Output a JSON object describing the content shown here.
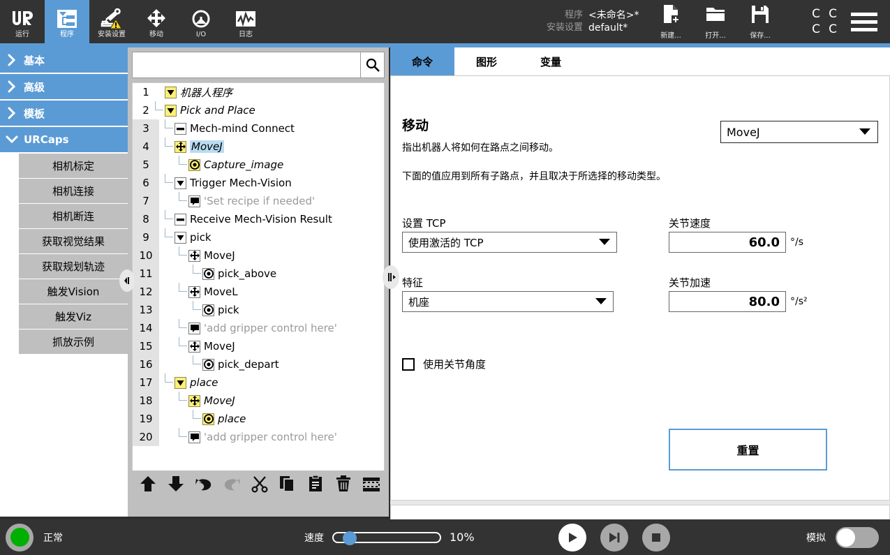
{
  "topnav": {
    "tabs": [
      {
        "label": "运行",
        "icon": "ur-logo-icon",
        "active": false
      },
      {
        "label": "程序",
        "icon": "program-tree-icon",
        "active": true
      },
      {
        "label": "安装设置",
        "icon": "robot-warning-icon",
        "active": false
      },
      {
        "label": "移动",
        "icon": "move-arrows-icon",
        "active": false
      },
      {
        "label": "I/O",
        "icon": "io-icon",
        "active": false
      },
      {
        "label": "日志",
        "icon": "log-waveform-icon",
        "active": false
      }
    ],
    "program_key": "程序",
    "program_value": "<未命名>*",
    "installation_key": "安装设置",
    "installation_value": "default*",
    "file_buttons": [
      {
        "label": "新建...",
        "icon": "new-file-icon"
      },
      {
        "label": "打开...",
        "icon": "open-folder-icon"
      },
      {
        "label": "保存...",
        "icon": "save-disk-icon"
      }
    ],
    "cc_letters": [
      "C",
      "C",
      "C",
      "C"
    ],
    "menu_icon": "hamburger-menu-icon",
    "accent_color": "#5b9bd5"
  },
  "sidebar": {
    "groups": [
      {
        "label": "基本",
        "expanded": false
      },
      {
        "label": "高级",
        "expanded": false
      },
      {
        "label": "模板",
        "expanded": false
      },
      {
        "label": "URCaps",
        "expanded": true
      }
    ],
    "urcaps_items": [
      "相机标定",
      "相机连接",
      "相机断连",
      "获取视觉结果",
      "获取规划轨迹",
      "触发Vision",
      "触发Viz",
      "抓放示例"
    ]
  },
  "tree_panel": {
    "search_value": "",
    "search_placeholder": "",
    "search_icon": "search-icon",
    "rows": [
      {
        "no": "1",
        "indent": 0,
        "icon": "folder-triangle",
        "hl": true,
        "label": "机器人程序",
        "italic": true,
        "dim": false,
        "selected": false,
        "gutter": "plain"
      },
      {
        "no": "2",
        "indent": 1,
        "icon": "folder-triangle",
        "hl": true,
        "label": "Pick and Place",
        "italic": true,
        "dim": false,
        "selected": false,
        "gutter": "plain"
      },
      {
        "no": "3",
        "indent": 2,
        "icon": "dash",
        "hl": false,
        "label": "Mech-mind Connect",
        "italic": false,
        "dim": false,
        "selected": false,
        "gutter": "gray"
      },
      {
        "no": "4",
        "indent": 2,
        "icon": "move-cross",
        "hl": true,
        "label": "MoveJ",
        "italic": true,
        "dim": false,
        "selected": true,
        "gutter": "gray"
      },
      {
        "no": "5",
        "indent": 3,
        "icon": "waypoint",
        "hl": true,
        "label": "Capture_image",
        "italic": true,
        "dim": false,
        "selected": false,
        "gutter": "gray"
      },
      {
        "no": "6",
        "indent": 2,
        "icon": "folder-triangle",
        "hl": false,
        "label": "Trigger Mech-Vision",
        "italic": false,
        "dim": false,
        "selected": false,
        "gutter": "gray"
      },
      {
        "no": "7",
        "indent": 3,
        "icon": "comment",
        "hl": false,
        "label": "'Set recipe if needed'",
        "italic": false,
        "dim": true,
        "selected": false,
        "gutter": "gray"
      },
      {
        "no": "8",
        "indent": 2,
        "icon": "dash",
        "hl": false,
        "label": "Receive Mech-Vision Result",
        "italic": false,
        "dim": false,
        "selected": false,
        "gutter": "gray"
      },
      {
        "no": "9",
        "indent": 2,
        "icon": "folder-triangle",
        "hl": false,
        "label": "pick",
        "italic": false,
        "dim": false,
        "selected": false,
        "gutter": "gray"
      },
      {
        "no": "10",
        "indent": 3,
        "icon": "move-cross",
        "hl": false,
        "label": "MoveJ",
        "italic": false,
        "dim": false,
        "selected": false,
        "gutter": "gray"
      },
      {
        "no": "11",
        "indent": 4,
        "icon": "waypoint",
        "hl": false,
        "label": "pick_above",
        "italic": false,
        "dim": false,
        "selected": false,
        "gutter": "gray"
      },
      {
        "no": "12",
        "indent": 3,
        "icon": "move-cross",
        "hl": false,
        "label": "MoveL",
        "italic": false,
        "dim": false,
        "selected": false,
        "gutter": "gray"
      },
      {
        "no": "13",
        "indent": 4,
        "icon": "waypoint",
        "hl": false,
        "label": "pick",
        "italic": false,
        "dim": false,
        "selected": false,
        "gutter": "gray"
      },
      {
        "no": "14",
        "indent": 3,
        "icon": "comment",
        "hl": false,
        "label": "'add gripper control here'",
        "italic": false,
        "dim": true,
        "selected": false,
        "gutter": "gray"
      },
      {
        "no": "15",
        "indent": 3,
        "icon": "move-cross",
        "hl": false,
        "label": "MoveJ",
        "italic": false,
        "dim": false,
        "selected": false,
        "gutter": "gray"
      },
      {
        "no": "16",
        "indent": 4,
        "icon": "waypoint",
        "hl": false,
        "label": "pick_depart",
        "italic": false,
        "dim": false,
        "selected": false,
        "gutter": "gray"
      },
      {
        "no": "17",
        "indent": 2,
        "icon": "folder-triangle",
        "hl": true,
        "label": "place",
        "italic": true,
        "dim": false,
        "selected": false,
        "gutter": "gray"
      },
      {
        "no": "18",
        "indent": 3,
        "icon": "move-cross",
        "hl": true,
        "label": "MoveJ",
        "italic": true,
        "dim": false,
        "selected": false,
        "gutter": "gray"
      },
      {
        "no": "19",
        "indent": 4,
        "icon": "waypoint",
        "hl": true,
        "label": "place",
        "italic": true,
        "dim": false,
        "selected": false,
        "gutter": "gray"
      },
      {
        "no": "20",
        "indent": 3,
        "icon": "comment",
        "hl": false,
        "label": "'add gripper control here'",
        "italic": false,
        "dim": true,
        "selected": false,
        "gutter": "gray"
      }
    ],
    "toolbar": [
      {
        "name": "move-up-button",
        "icon": "arrow-up-icon",
        "enabled": true
      },
      {
        "name": "move-down-button",
        "icon": "arrow-down-icon",
        "enabled": true
      },
      {
        "name": "undo-button",
        "icon": "undo-icon",
        "enabled": true
      },
      {
        "name": "redo-button",
        "icon": "redo-icon",
        "enabled": false
      },
      {
        "name": "cut-button",
        "icon": "scissors-icon",
        "enabled": true
      },
      {
        "name": "copy-button",
        "icon": "copy-icon",
        "enabled": true
      },
      {
        "name": "paste-button",
        "icon": "clipboard-icon",
        "enabled": true
      },
      {
        "name": "delete-button",
        "icon": "trash-icon",
        "enabled": true
      },
      {
        "name": "suppress-button",
        "icon": "suppress-icon",
        "enabled": true
      }
    ],
    "splitter_icon": "splitter-handle-icon",
    "sidebar_handle_icon": "collapse-handle-icon"
  },
  "right_panel": {
    "tabs": [
      {
        "label": "命令",
        "active": true
      },
      {
        "label": "图形",
        "active": false
      },
      {
        "label": "变量",
        "active": false
      }
    ],
    "title": "移动",
    "desc1": "指出机器人将如何在路点之间移动。",
    "desc2": "下面的值应用到所有子路点，并且取决于所选择的移动类型。",
    "move_type": "MoveJ",
    "fields": {
      "tcp_label": "设置 TCP",
      "tcp_value": "使用激活的 TCP",
      "feature_label": "特征",
      "feature_value": "机座",
      "joint_speed_label": "关节速度",
      "joint_speed_value": "60.0",
      "joint_speed_unit": "°/s",
      "joint_accel_label": "关节加速",
      "joint_accel_value": "80.0",
      "joint_accel_unit": "°/s²"
    },
    "use_joint_angles_label": "使用关节角度",
    "use_joint_angles_checked": false,
    "reset_label": "重置",
    "reset_border_color": "#5b9bd5"
  },
  "statusbar": {
    "state_label": "正常",
    "state_color": "#00b000",
    "speed_label": "速度",
    "speed_value": "10%",
    "speed_percent": 10,
    "transport": [
      {
        "name": "play-button",
        "icon": "play-icon",
        "state": "on"
      },
      {
        "name": "step-button",
        "icon": "step-icon",
        "state": "off"
      },
      {
        "name": "stop-button",
        "icon": "stop-icon",
        "state": "off"
      }
    ],
    "simulation_label": "模拟",
    "simulation_on": false
  }
}
